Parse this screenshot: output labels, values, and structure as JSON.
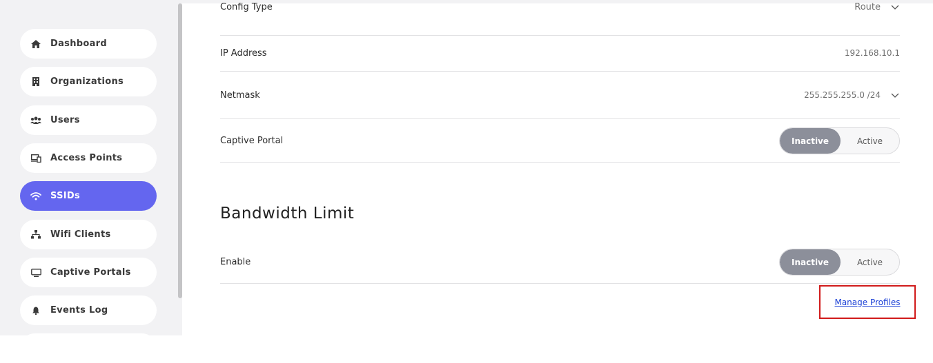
{
  "sidebar": {
    "items": [
      {
        "label": "Dashboard",
        "icon": "home-icon",
        "active": false
      },
      {
        "label": "Organizations",
        "icon": "building-icon",
        "active": false
      },
      {
        "label": "Users",
        "icon": "users-icon",
        "active": false
      },
      {
        "label": "Access Points",
        "icon": "devices-icon",
        "active": false
      },
      {
        "label": "SSIDs",
        "icon": "wifi-icon",
        "active": true
      },
      {
        "label": "Wifi Clients",
        "icon": "network-icon",
        "active": false
      },
      {
        "label": "Captive Portals",
        "icon": "monitor-icon",
        "active": false
      },
      {
        "label": "Events Log",
        "icon": "bell-icon",
        "active": false
      }
    ]
  },
  "settings": {
    "config_type": {
      "label": "Config Type",
      "value": "Route"
    },
    "ip_address": {
      "label": "IP Address",
      "value": "192.168.10.1"
    },
    "netmask": {
      "label": "Netmask",
      "value": "255.255.255.0 /24"
    },
    "captive_portal": {
      "label": "Captive Portal",
      "options": [
        "Inactive",
        "Active"
      ],
      "selected": "Inactive"
    }
  },
  "bandwidth": {
    "title": "Bandwidth Limit",
    "enable": {
      "label": "Enable",
      "options": [
        "Inactive",
        "Active"
      ],
      "selected": "Inactive"
    },
    "manage_link": "Manage Profiles"
  },
  "colors": {
    "accent": "#6466ef",
    "toggle_on": "#8c8f9a",
    "highlight_border": "#d11a1a",
    "link": "#1a3fd6"
  }
}
